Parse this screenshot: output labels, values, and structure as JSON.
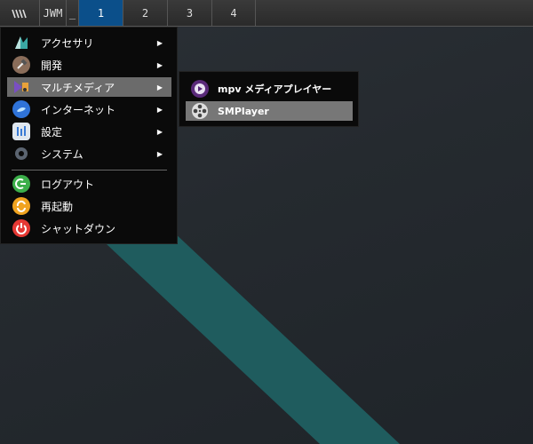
{
  "taskbar": {
    "logo_icon": "jwm-logo-icon",
    "jwm_label": "JWM",
    "minimize_label": "_",
    "workspaces": [
      "1",
      "2",
      "3",
      "4"
    ],
    "active_workspace": "1",
    "active_color": "#0b4f8a"
  },
  "menu": {
    "items": [
      {
        "label": "アクセサリ",
        "icon": "accessories-icon",
        "has_submenu": true
      },
      {
        "label": "開発",
        "icon": "development-hammer-icon",
        "has_submenu": true
      },
      {
        "label": "マルチメディア",
        "icon": "multimedia-icon",
        "has_submenu": true,
        "selected": true
      },
      {
        "label": "インターネット",
        "icon": "internet-globe-icon",
        "has_submenu": true
      },
      {
        "label": "設定",
        "icon": "settings-sliders-icon",
        "has_submenu": true
      },
      {
        "label": "システム",
        "icon": "system-gear-icon",
        "has_submenu": true
      },
      {
        "label": "ログアウト",
        "icon": "logout-icon",
        "has_submenu": false
      },
      {
        "label": "再起動",
        "icon": "restart-icon",
        "has_submenu": false
      },
      {
        "label": "シャットダウン",
        "icon": "shutdown-icon",
        "has_submenu": false
      }
    ],
    "arrow": "▶"
  },
  "submenu": {
    "items": [
      {
        "label": "mpv メディアプレイヤー",
        "icon": "mpv-icon"
      },
      {
        "label": "SMPlayer",
        "icon": "smplayer-reel-icon",
        "selected": true
      }
    ]
  },
  "colors": {
    "desktop_bg": "#26292e",
    "teal_stripe": "#1f5c5e",
    "menu_bg": "#0a0a0a",
    "selected_bg": "#6b6b6b"
  }
}
